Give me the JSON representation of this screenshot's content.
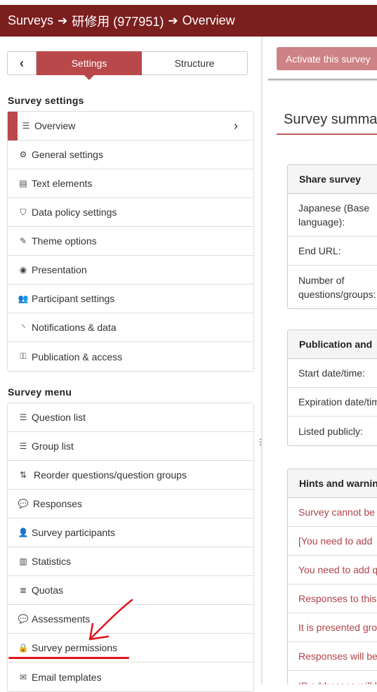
{
  "header": {
    "crumb1": "Surveys",
    "crumb2": "研修用 (977951)",
    "crumb3": "Overview"
  },
  "sidebar": {
    "back_icon": "chevron-left-icon",
    "tab_settings": "Settings",
    "tab_structure": "Structure",
    "settings_title": "Survey settings",
    "settings_items": [
      {
        "label": "Overview",
        "icon": "list-icon"
      },
      {
        "label": "General settings",
        "icon": "cogs-icon"
      },
      {
        "label": "Text elements",
        "icon": "file-text-icon"
      },
      {
        "label": "Data policy settings",
        "icon": "shield-icon"
      },
      {
        "label": "Theme options",
        "icon": "paint-brush-icon"
      },
      {
        "label": "Presentation",
        "icon": "eye-slash-icon"
      },
      {
        "label": "Participant settings",
        "icon": "users-icon"
      },
      {
        "label": "Notifications & data",
        "icon": "rss-icon"
      },
      {
        "label": "Publication & access",
        "icon": "key-icon"
      }
    ],
    "menu_title": "Survey menu",
    "menu_items": [
      {
        "label": "Question list",
        "icon": "list-icon"
      },
      {
        "label": "Group list",
        "icon": "list-icon"
      },
      {
        "label": "Reorder questions/question groups",
        "icon": "reorder-icon"
      },
      {
        "label": "Responses",
        "icon": "comment-icon"
      },
      {
        "label": "Survey participants",
        "icon": "user-icon"
      },
      {
        "label": "Statistics",
        "icon": "bar-chart-icon"
      },
      {
        "label": "Quotas",
        "icon": "tasks-icon"
      },
      {
        "label": "Assessments",
        "icon": "comment-icon"
      },
      {
        "label": "Survey permissions",
        "icon": "lock-icon"
      },
      {
        "label": "Email templates",
        "icon": "envelope-icon"
      }
    ]
  },
  "main": {
    "activate_label": "Activate this survey",
    "summary_title": "Survey summa",
    "panels": [
      {
        "title": "Share survey",
        "rows": [
          "Japanese (Base\nlanguage):",
          "End URL:",
          "Number of\nquestions/groups:"
        ]
      },
      {
        "title": "Publication and",
        "rows": [
          "Start date/time:",
          "Expiration date/tim",
          "Listed publicly:"
        ]
      },
      {
        "title": "Hints and warnin",
        "rows": [
          "Survey cannot be",
          "[You need to add",
          "You need to add q",
          "Responses to this",
          "It is presented gro",
          "Responses will be",
          "IP addresses will b"
        ]
      }
    ]
  },
  "colors": {
    "header_bg": "#7b1e1e",
    "accent": "#b8484a",
    "warning_text": "#b04448",
    "annotation": "#e2141b"
  }
}
